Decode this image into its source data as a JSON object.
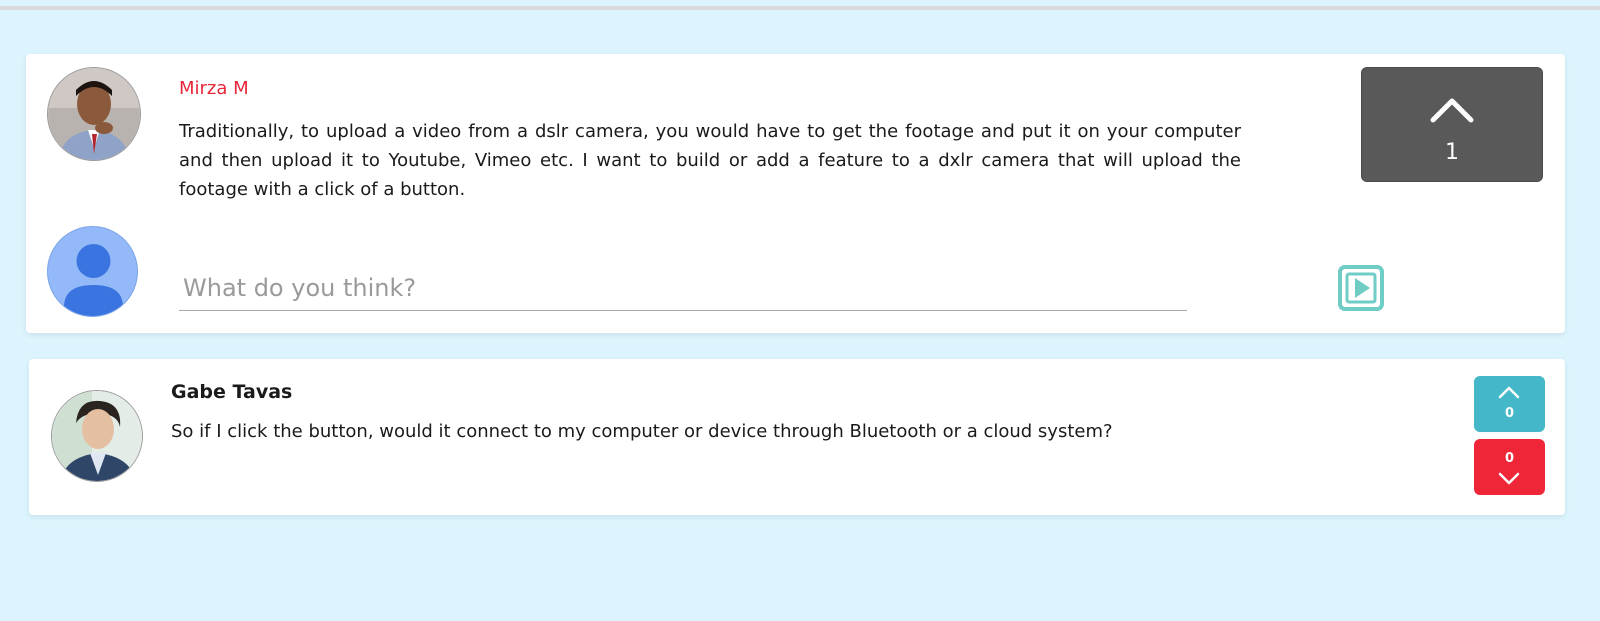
{
  "post": {
    "author": "Mirza M",
    "body": "Traditionally, to upload a video from a dslr camera, you would have to get the footage and put it on your computer and then upload it to Youtube, Vimeo etc. I want to build or add a feature to a dxlr camera that will upload the footage with a click of a button.",
    "upvote_count": "1",
    "upvote_icon": "chevron-up-icon"
  },
  "composer": {
    "placeholder": "What do you think?",
    "value": "",
    "send_icon": "play-icon",
    "avatar_icon": "user-icon"
  },
  "reply": {
    "author": "Gabe Tavas",
    "body": "So if I click the button, would it connect to my computer or device through Bluetooth or a cloud system?",
    "upvotes": "0",
    "downvotes": "0"
  },
  "colors": {
    "background": "#dcf4fd",
    "author_accent": "#e8263a",
    "upvote_big": "#595959",
    "upvote_small": "#44b8c8",
    "downvote": "#ee2638",
    "send_icon": "#6fcdc6"
  }
}
